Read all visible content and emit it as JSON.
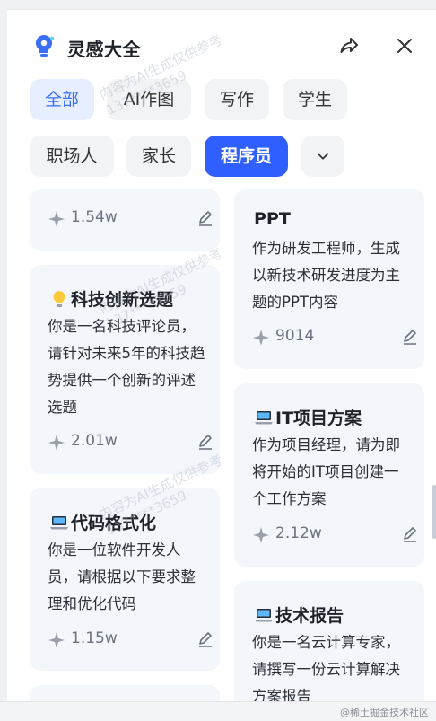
{
  "header": {
    "title": "灵感大全",
    "logo": "lightbulb-logo-icon",
    "share_icon": "share-icon",
    "close_icon": "close-icon"
  },
  "tabs": [
    {
      "label": "全部",
      "state": "soft-selected"
    },
    {
      "label": "AI作图"
    },
    {
      "label": "写作"
    },
    {
      "label": "学生"
    },
    {
      "label": "职场人"
    },
    {
      "label": "家长"
    },
    {
      "label": "程序员",
      "state": "selected"
    },
    {
      "icon": "chevron-down-icon"
    }
  ],
  "cards": [
    {
      "title": "",
      "desc": "",
      "stat": "1.54w"
    },
    {
      "title": "PPT",
      "desc": "作为研发工程师，生成以新技术研发进度为主题的PPT内容",
      "stat": "9014"
    },
    {
      "icon": "lightbulb-emoji-icon",
      "title": "科技创新选题",
      "desc": "你是一名科技评论员，请针对未来5年的科技趋势提供一个创新的评述选题",
      "stat": "2.01w"
    },
    {
      "icon": "laptop-emoji-icon",
      "title": "IT项目方案",
      "desc": "作为项目经理，请为即将开始的IT项目创建一个工作方案",
      "stat": "2.12w"
    },
    {
      "icon": "laptop-emoji-icon",
      "title": "代码格式化",
      "desc": "你是一位软件开发人员，请根据以下要求整理和优化代码",
      "stat": "1.15w"
    },
    {
      "icon": "laptop-emoji-icon",
      "title": "技术报告",
      "desc": "你是一名云计算专家，请撰写一份云计算解决方案报告"
    }
  ],
  "watermark": {
    "line1": "内容为AI生成仅供参考",
    "line2": "137****3659"
  },
  "footer_note": "@稀土掘金技术社区",
  "colors": {
    "accent": "#2f5fff",
    "chip_bg": "#f2f3f5",
    "card_bg": "#f3f6fa"
  }
}
